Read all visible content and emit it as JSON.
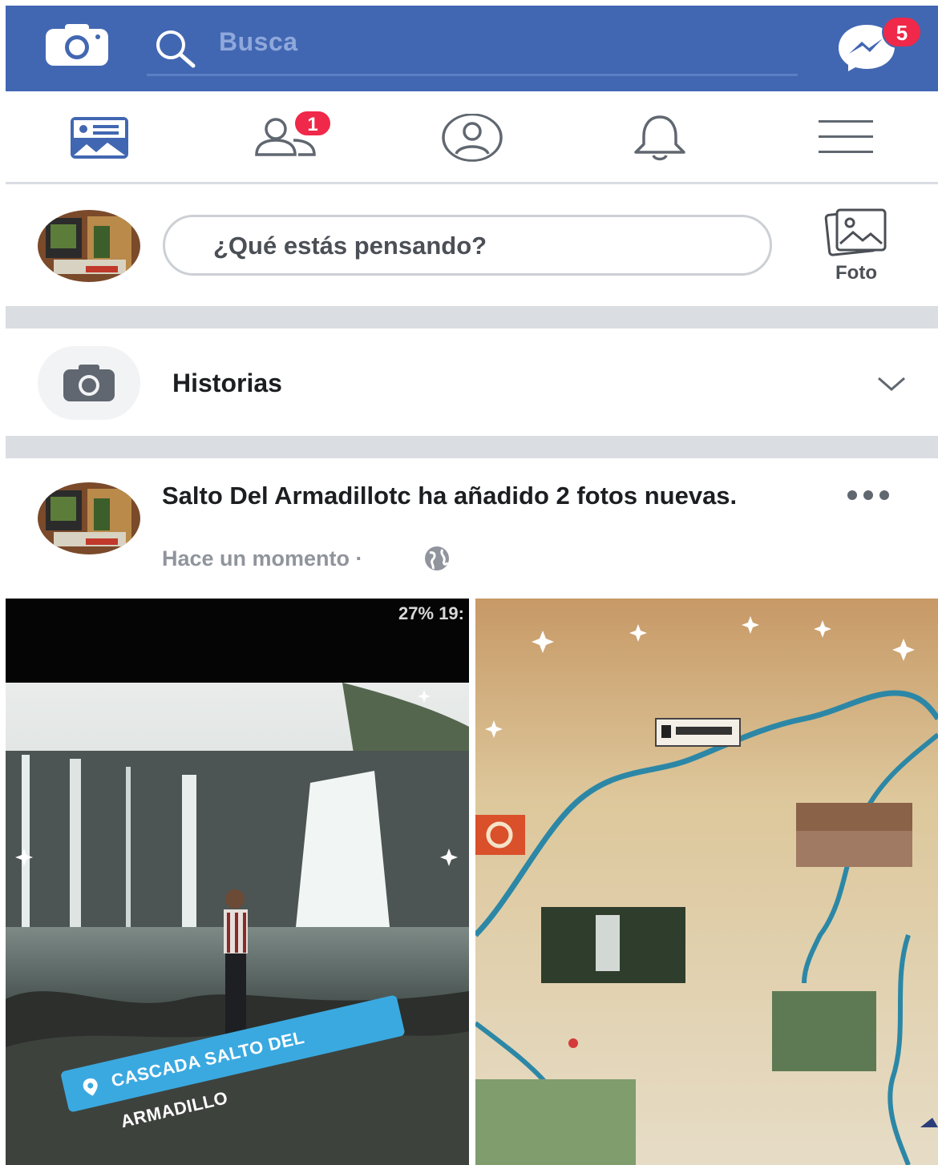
{
  "header": {
    "search_placeholder": "Busca",
    "messenger_badge": "5"
  },
  "nav": {
    "friends_badge": "1",
    "tabs": [
      "news-feed",
      "friends",
      "profile",
      "notifications",
      "menu"
    ]
  },
  "composer": {
    "placeholder": "¿Qué estás pensando?",
    "photo_label": "Foto"
  },
  "stories": {
    "title": "Historias"
  },
  "post": {
    "title": "Salto Del Armadillotc ha añadido 2 fotos nuevas.",
    "time": "Hace un momento ·",
    "photo1_status": "27% 19:",
    "photo1_location_tag": "CASCADA SALTO DEL ARMADILLO"
  },
  "colors": {
    "brand_blue": "#4267b2",
    "badge_red": "#f02849",
    "divider_gray": "#dadde1",
    "text_dark": "#1c1e21",
    "text_meta": "#90949c"
  }
}
